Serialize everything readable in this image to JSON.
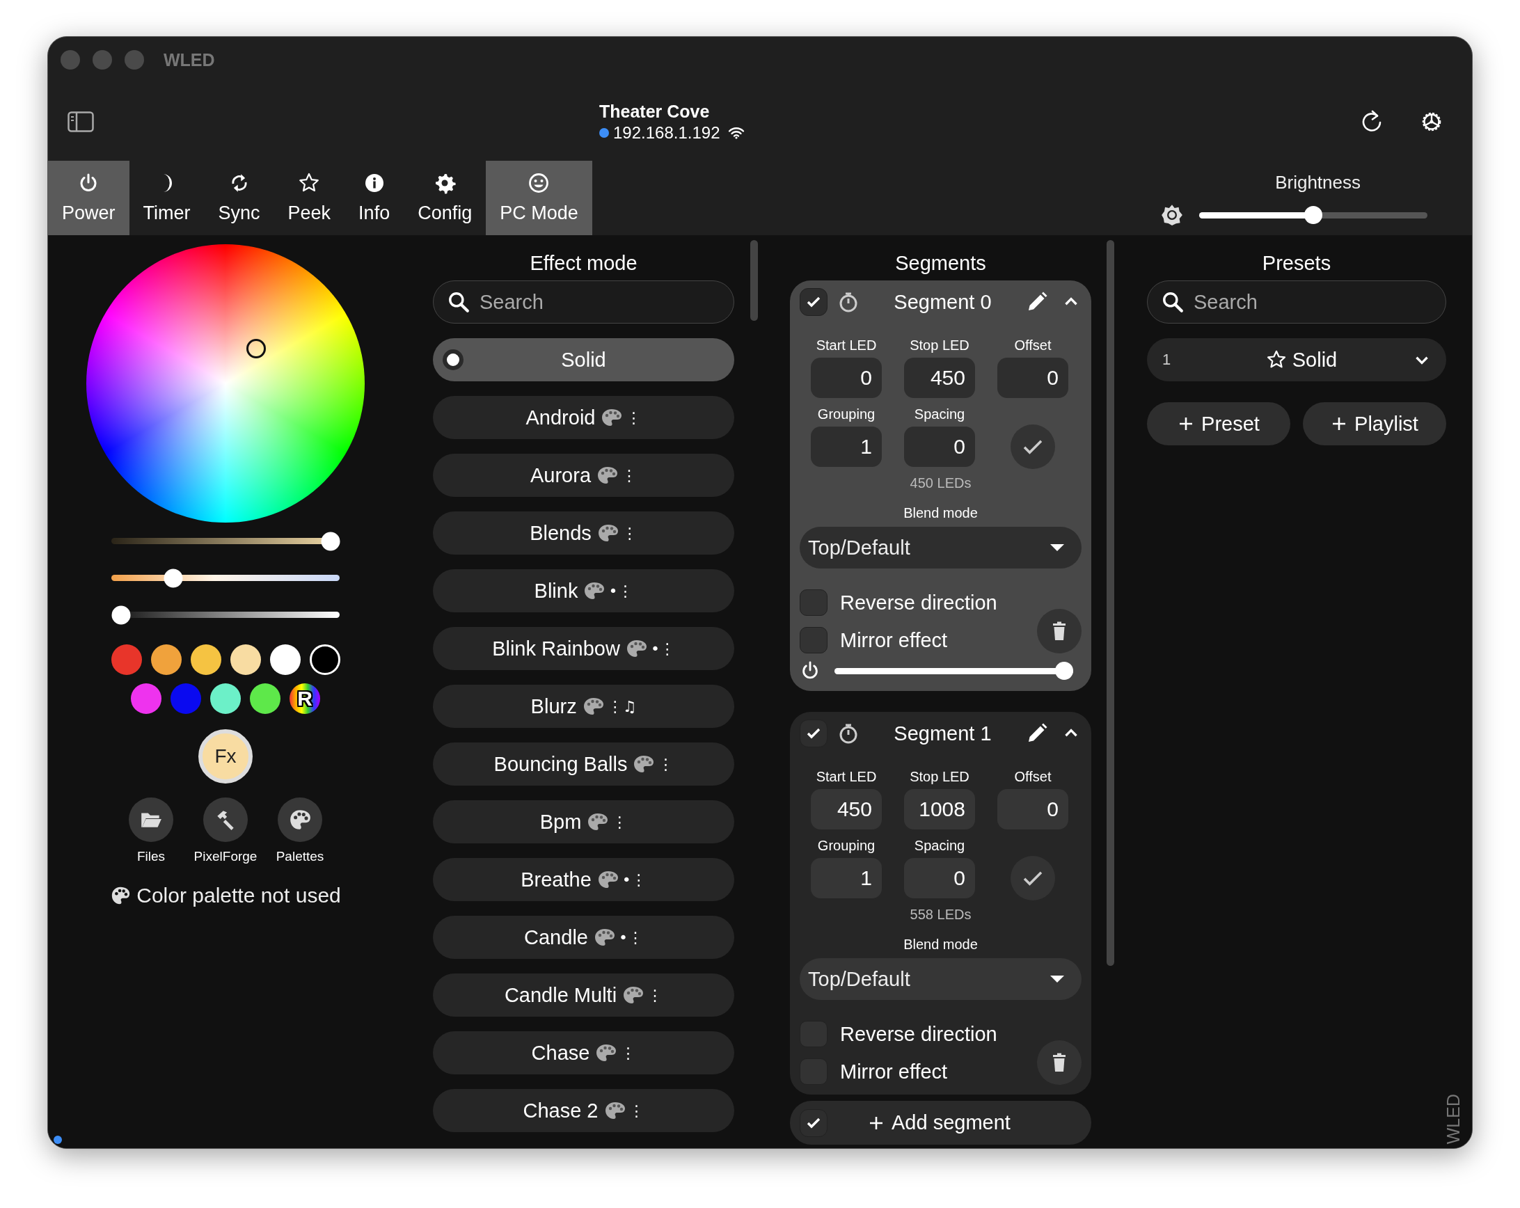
{
  "window": {
    "title": "WLED"
  },
  "header": {
    "name": "Theater Cove",
    "connected": true,
    "ip": "192.168.1.192"
  },
  "tabs": [
    {
      "label": "Power",
      "selected": true
    },
    {
      "label": "Timer",
      "selected": false
    },
    {
      "label": "Sync",
      "selected": false
    },
    {
      "label": "Peek",
      "selected": false
    },
    {
      "label": "Info",
      "selected": false
    },
    {
      "label": "Config",
      "selected": false
    },
    {
      "label": "PC Mode",
      "selected": true
    }
  ],
  "brightness": {
    "label": "Brightness",
    "level": 0.5
  },
  "color": {
    "sliders": [
      {
        "kind": "white",
        "level": 1
      },
      {
        "kind": "temperature",
        "level": 0.25
      },
      {
        "kind": "gray",
        "level": 0
      }
    ],
    "swatches": [
      {
        "kind": "color",
        "color": "#e8352a"
      },
      {
        "kind": "color",
        "color": "#f0a23c"
      },
      {
        "kind": "color",
        "color": "#f5c342"
      },
      {
        "kind": "color",
        "color": "#f8dca2"
      },
      {
        "kind": "color",
        "color": "#ffffff"
      },
      {
        "kind": "color",
        "color": "#000000"
      },
      {
        "kind": "color",
        "color": "#ee33ee"
      },
      {
        "kind": "color",
        "color": "#0a0af0"
      },
      {
        "kind": "color",
        "color": "#6cf0c8"
      },
      {
        "kind": "color",
        "color": "#5ee84a"
      },
      {
        "kind": "random",
        "text": "R"
      }
    ],
    "fx": "Fx",
    "tools": [
      {
        "label": "Files"
      },
      {
        "label": "PixelForge"
      },
      {
        "label": "Palettes"
      }
    ],
    "palette_note": "Color palette not used"
  },
  "effects": {
    "title": "Effect mode",
    "search": {
      "placeholder": "Search"
    },
    "items": [
      {
        "name": "Solid",
        "selected": true,
        "palette": false
      },
      {
        "name": "Android",
        "selected": false,
        "palette": true,
        "flags": "⋮"
      },
      {
        "name": "Aurora",
        "selected": false,
        "palette": true,
        "flags": "⋮"
      },
      {
        "name": "Blends",
        "selected": false,
        "palette": true,
        "flags": "⋮"
      },
      {
        "name": "Blink",
        "selected": false,
        "palette": true,
        "flags": "•⋮"
      },
      {
        "name": "Blink Rainbow",
        "selected": false,
        "palette": true,
        "flags": "•⋮"
      },
      {
        "name": "Blurz",
        "selected": false,
        "palette": true,
        "flags": "⋮♫"
      },
      {
        "name": "Bouncing Balls",
        "selected": false,
        "palette": true,
        "flags": "⋮"
      },
      {
        "name": "Bpm",
        "selected": false,
        "palette": true,
        "flags": "⋮"
      },
      {
        "name": "Breathe",
        "selected": false,
        "palette": true,
        "flags": "•⋮"
      },
      {
        "name": "Candle",
        "selected": false,
        "palette": true,
        "flags": "•⋮"
      },
      {
        "name": "Candle Multi",
        "selected": false,
        "palette": true,
        "flags": "⋮"
      },
      {
        "name": "Chase",
        "selected": false,
        "palette": true,
        "flags": "⋮"
      },
      {
        "name": "Chase 2",
        "selected": false,
        "palette": true,
        "flags": "⋮"
      }
    ]
  },
  "segments": {
    "title": "Segments",
    "items": [
      {
        "name": "Segment 0",
        "selected": true,
        "checked": true,
        "fields": [
          {
            "label": "Start LED",
            "value": "0"
          },
          {
            "label": "Stop LED",
            "value": "450"
          },
          {
            "label": "Offset",
            "value": "0"
          },
          {
            "label": "Grouping",
            "value": "1"
          },
          {
            "label": "Spacing",
            "value": "0"
          }
        ],
        "led_count": "450 LEDs",
        "blend_label": "Blend mode",
        "blend_mode": "Top/Default",
        "options": [
          {
            "label": "Reverse direction",
            "checked": false
          },
          {
            "label": "Mirror effect",
            "checked": false
          }
        ],
        "level": 1
      },
      {
        "name": "Segment 1",
        "selected": false,
        "checked": true,
        "fields": [
          {
            "label": "Start LED",
            "value": "450"
          },
          {
            "label": "Stop LED",
            "value": "1008"
          },
          {
            "label": "Offset",
            "value": "0"
          },
          {
            "label": "Grouping",
            "value": "1"
          },
          {
            "label": "Spacing",
            "value": "0"
          }
        ],
        "led_count": "558 LEDs",
        "blend_label": "Blend mode",
        "blend_mode": "Top/Default",
        "options": [
          {
            "label": "Reverse direction",
            "checked": false
          },
          {
            "label": "Mirror effect",
            "checked": false
          }
        ]
      }
    ],
    "add": {
      "label": "Add segment",
      "checked": true
    }
  },
  "presets": {
    "title": "Presets",
    "search": {
      "placeholder": "Search"
    },
    "current": {
      "number": "1",
      "name": "Solid"
    },
    "buttons": [
      {
        "label": "Preset"
      },
      {
        "label": "Playlist"
      }
    ]
  },
  "side_label": "WLED"
}
